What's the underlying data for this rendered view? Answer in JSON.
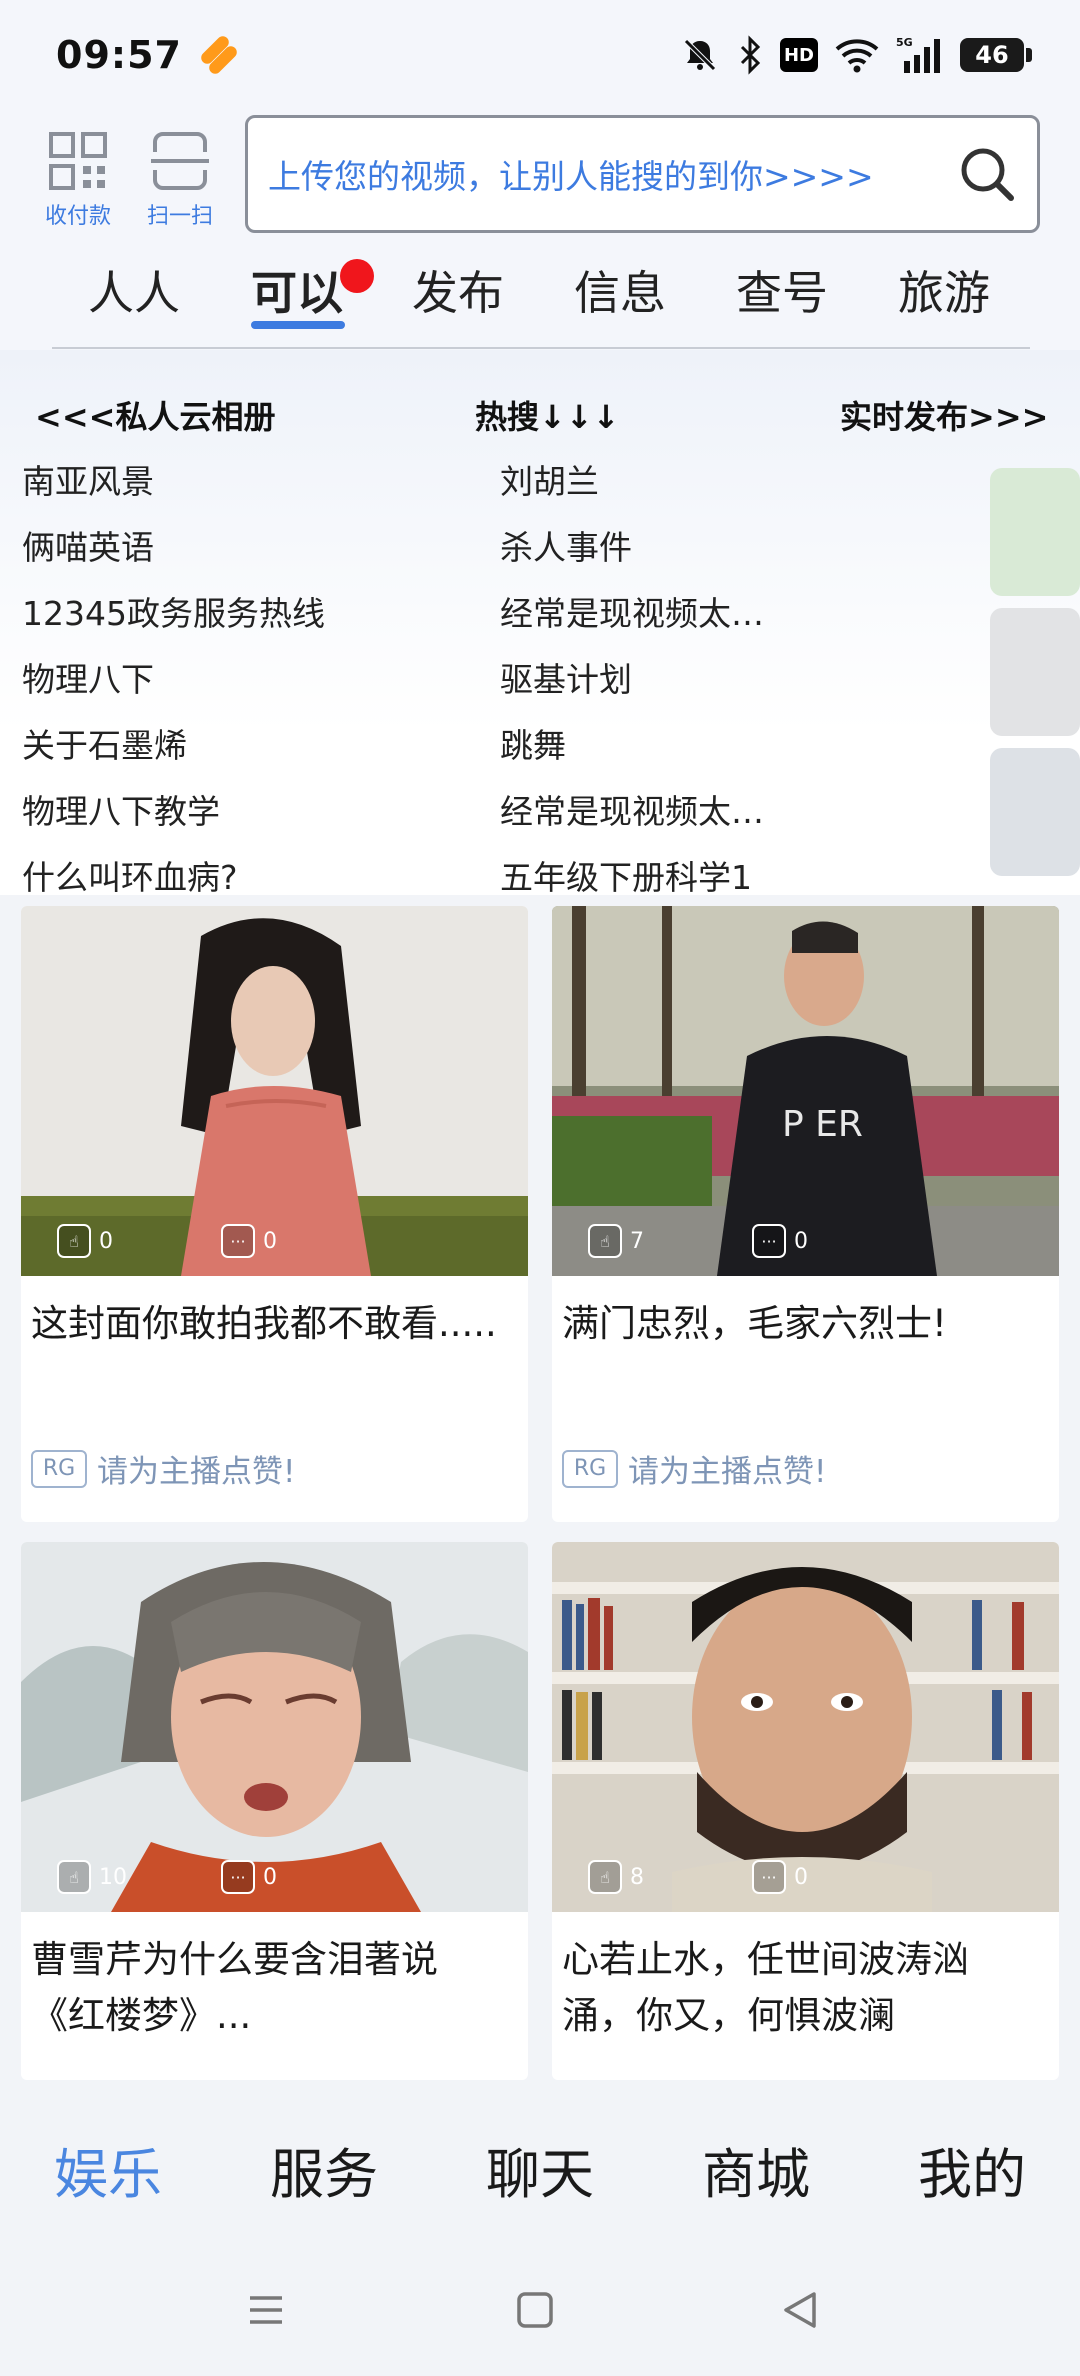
{
  "status_bar": {
    "time": "09:57",
    "hd_label": "HD",
    "network_label": "5G",
    "battery": "46"
  },
  "header": {
    "quick_actions": [
      {
        "label": "收付款",
        "icon": "qr-code-icon"
      },
      {
        "label": "扫一扫",
        "icon": "scan-icon"
      }
    ],
    "search_placeholder": "上传您的视频，让别人能搜的到你>>>>"
  },
  "tabs": [
    {
      "label": "人人"
    },
    {
      "label": "可以",
      "active": true,
      "badge": "red-dot"
    },
    {
      "label": "发布"
    },
    {
      "label": "信息"
    },
    {
      "label": "查号"
    },
    {
      "label": "旅游"
    }
  ],
  "hot_panel": {
    "left_header": "<<<私人云相册",
    "center_header": "热搜↓↓↓",
    "right_header": "实时发布>>>",
    "left_items": [
      "南亚风景",
      "俩喵英语",
      "12345政务服务热线",
      "物理八下",
      "关于石墨烯",
      "物理八下教学",
      "什么叫环血病?"
    ],
    "right_items": [
      "刘胡兰",
      "杀人事件",
      "经常是现视频太…",
      "驱基计划",
      "跳舞",
      "经常是现视频太…",
      "五年级下册科学1"
    ]
  },
  "videos": [
    {
      "likes": "0",
      "comments": "0",
      "title": "这封面你敢拍我都不敢看.....",
      "badge": "RG",
      "footer": "请为主播点赞!"
    },
    {
      "likes": "7",
      "comments": "0",
      "title": "满门忠烈，毛家六烈士!",
      "badge": "RG",
      "footer": "请为主播点赞!"
    },
    {
      "likes": "10",
      "comments": "0",
      "title": "曹雪芹为什么要含泪著说《红楼梦》..."
    },
    {
      "likes": "8",
      "comments": "0",
      "title": "心若止水，任世间波涛汹涌，你又，何惧波澜"
    }
  ],
  "bottom_nav": [
    {
      "label": "娱乐",
      "active": true
    },
    {
      "label": "服务"
    },
    {
      "label": "聊天"
    },
    {
      "label": "商城"
    },
    {
      "label": "我的"
    }
  ],
  "colors": {
    "accent": "#3d7be0",
    "badge_red": "#f0161c",
    "muted_blue": "#7e95b6"
  }
}
